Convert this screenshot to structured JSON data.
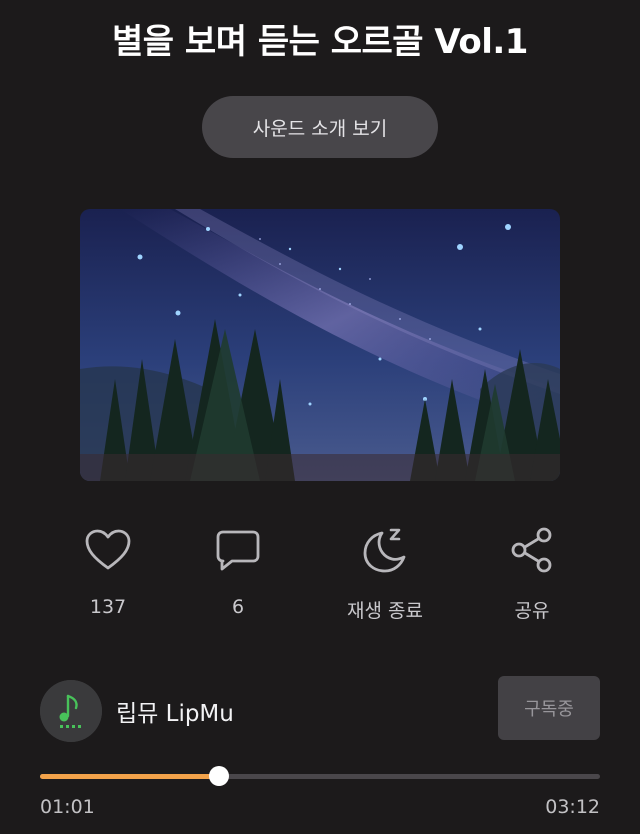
{
  "title": "별을 보며 듣는 오르골 Vol.1",
  "intro_button": "사운드 소개 보기",
  "actions": [
    {
      "label": "137",
      "icon": "heart-icon"
    },
    {
      "label": "6",
      "icon": "comment-icon"
    },
    {
      "label": "재생 종료",
      "icon": "moon-sleep-icon"
    },
    {
      "label": "공유",
      "icon": "share-icon"
    }
  ],
  "channel": {
    "name": "립뮤 LipMu",
    "subscribe_label": "구독중"
  },
  "player": {
    "current_time": "01:01",
    "total_time": "03:12",
    "progress_fraction": 0.32
  },
  "colors": {
    "background": "#1c1a1b",
    "progress_accent": "#f2a24a",
    "button_bg": "#48464a"
  }
}
